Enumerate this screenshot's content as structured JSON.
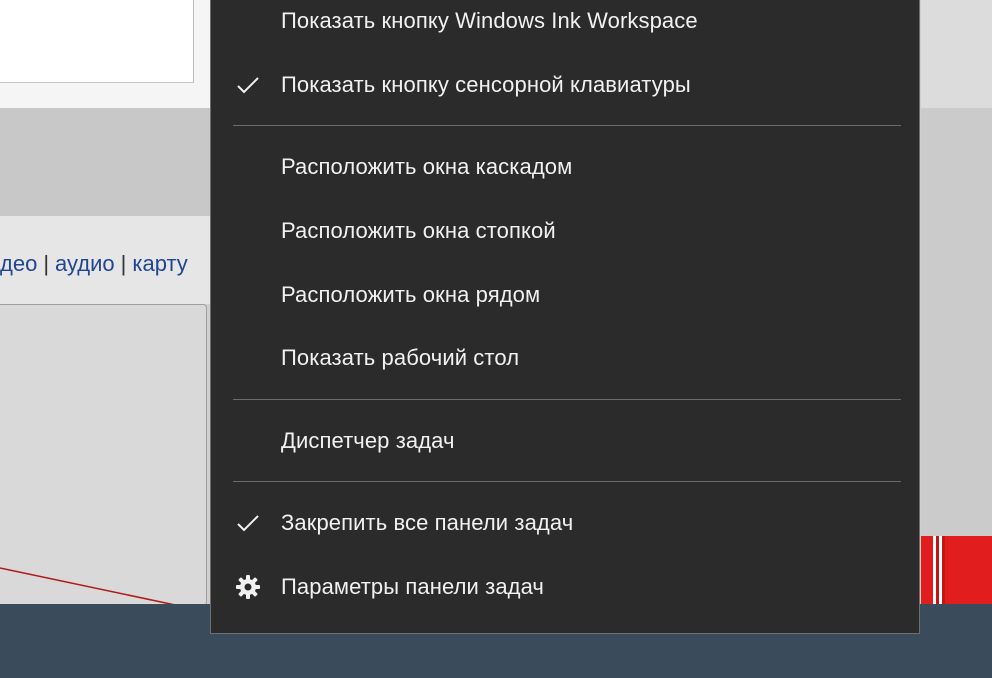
{
  "background": {
    "links": [
      "деo",
      "аудио",
      "карту"
    ]
  },
  "menu": {
    "items": [
      {
        "label": "Показать кнопку Windows Ink Workspace",
        "check": false,
        "icon": ""
      },
      {
        "label": "Показать кнопку сенсорной клавиатуры",
        "check": true,
        "icon": "checkmark-icon"
      },
      {
        "label": "Расположить окна каскадом",
        "check": false,
        "icon": ""
      },
      {
        "label": "Расположить окна стопкой",
        "check": false,
        "icon": ""
      },
      {
        "label": "Расположить окна рядом",
        "check": false,
        "icon": ""
      },
      {
        "label": "Показать рабочий стол",
        "check": false,
        "icon": ""
      },
      {
        "label": "Диспетчер задач",
        "check": false,
        "icon": ""
      },
      {
        "label": "Закрепить все панели задач",
        "check": true,
        "icon": "checkmark-icon"
      },
      {
        "label": "Параметры панели задач",
        "check": false,
        "icon": "gear-icon"
      }
    ]
  },
  "colors": {
    "menu_bg": "#2b2b2b",
    "menu_text": "#f1f1f1",
    "taskbar": "#3a4c5c",
    "accent_red": "#e21d1d",
    "link": "#21458f"
  }
}
